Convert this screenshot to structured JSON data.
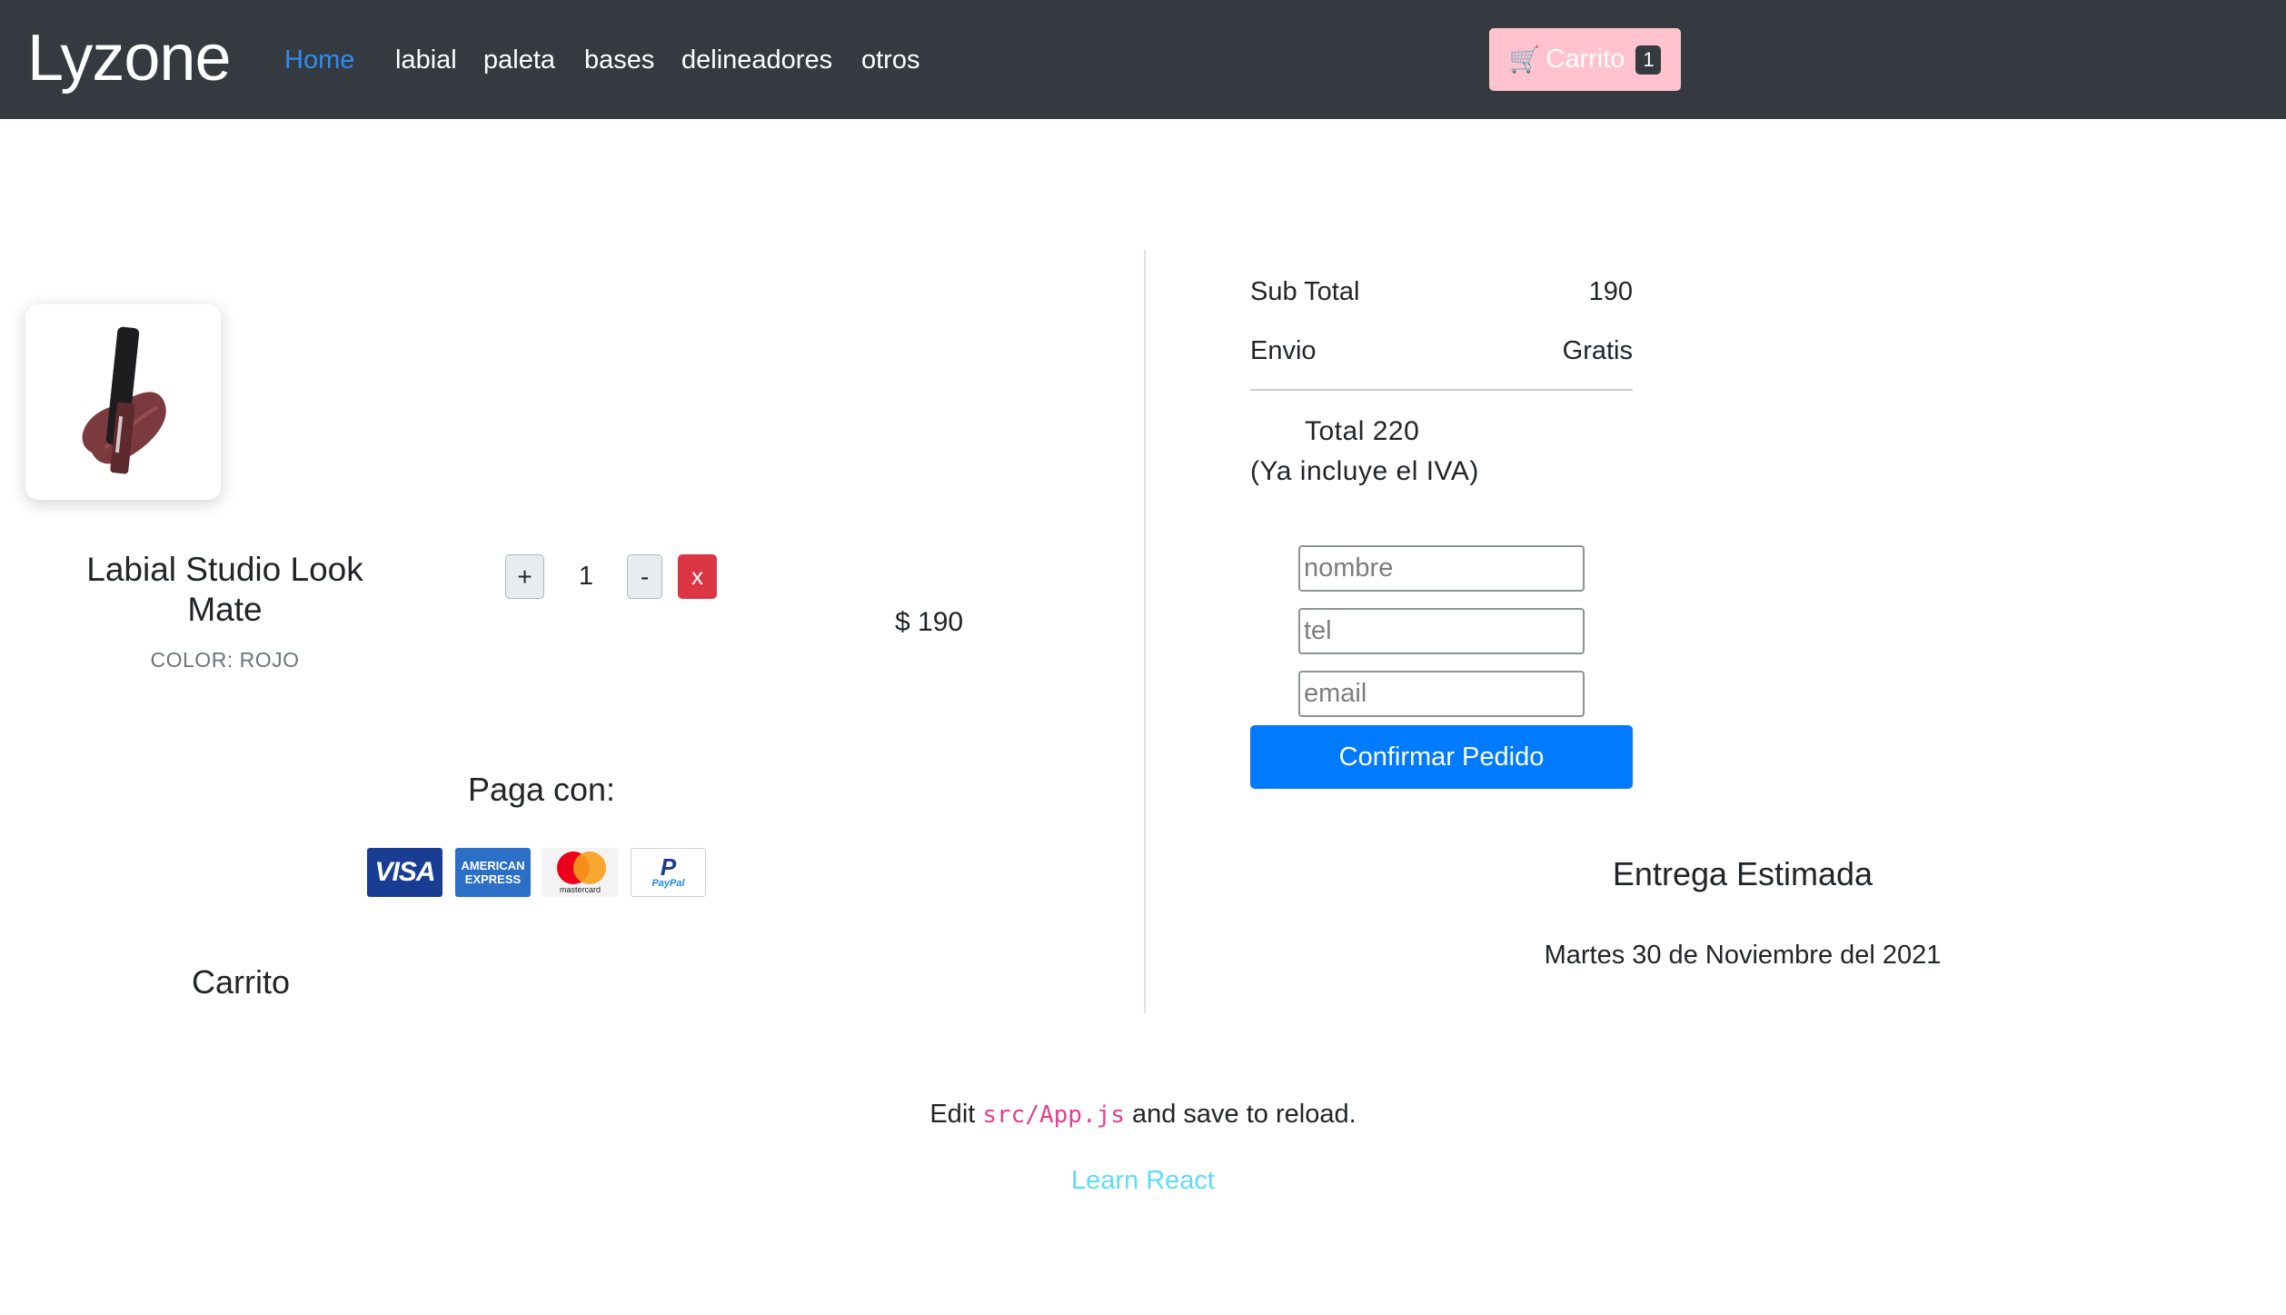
{
  "navbar": {
    "brand": "Lyzone",
    "links": [
      {
        "label": "Home",
        "active": true
      },
      {
        "label": "labial"
      },
      {
        "label": "paleta"
      },
      {
        "label": "bases"
      },
      {
        "label": "delineadores"
      },
      {
        "label": "otros"
      }
    ],
    "cart": {
      "icon": "shopping-cart-icon",
      "label": "Carrito",
      "count": "1"
    }
  },
  "cart_item": {
    "name": "Labial Studio Look Mate",
    "color": "COLOR: ROJO",
    "plus": "+",
    "quantity": "1",
    "minus": "-",
    "remove": "x",
    "price": "$ 190"
  },
  "payment": {
    "title": "Paga con:",
    "methods": [
      {
        "name": "visa",
        "label": "VISA"
      },
      {
        "name": "amex",
        "label": "AMERICAN EXPRESS"
      },
      {
        "name": "mastercard",
        "label": "mastercard"
      },
      {
        "name": "paypal",
        "label": "PayPal"
      }
    ]
  },
  "carrito_label": "Carrito",
  "summary": {
    "subtotal_label": "Sub Total",
    "subtotal_value": "190",
    "envio_label": "Envio",
    "envio_value": "Gratis",
    "total": "Total 220",
    "iva_note": "(Ya incluye el IVA)"
  },
  "form": {
    "nombre_placeholder": "nombre",
    "tel_placeholder": "tel",
    "email_placeholder": "email",
    "submit": "Confirmar Pedido"
  },
  "delivery": {
    "title": "Entrega Estimada",
    "date": "Martes 30 de Noviembre del 2021"
  },
  "footer": {
    "edit_prefix": "Edit ",
    "edit_code": "src/App.js",
    "edit_suffix": " and save to reload.",
    "learn_link": "Learn React"
  },
  "colors": {
    "navbar_bg": "#343a40",
    "active_link": "#2f8cf2",
    "cart_button": "#ffc2ce",
    "primary": "#007bff",
    "danger": "#dc3545",
    "react_link": "#61dafb",
    "code": "#e83e8c"
  }
}
